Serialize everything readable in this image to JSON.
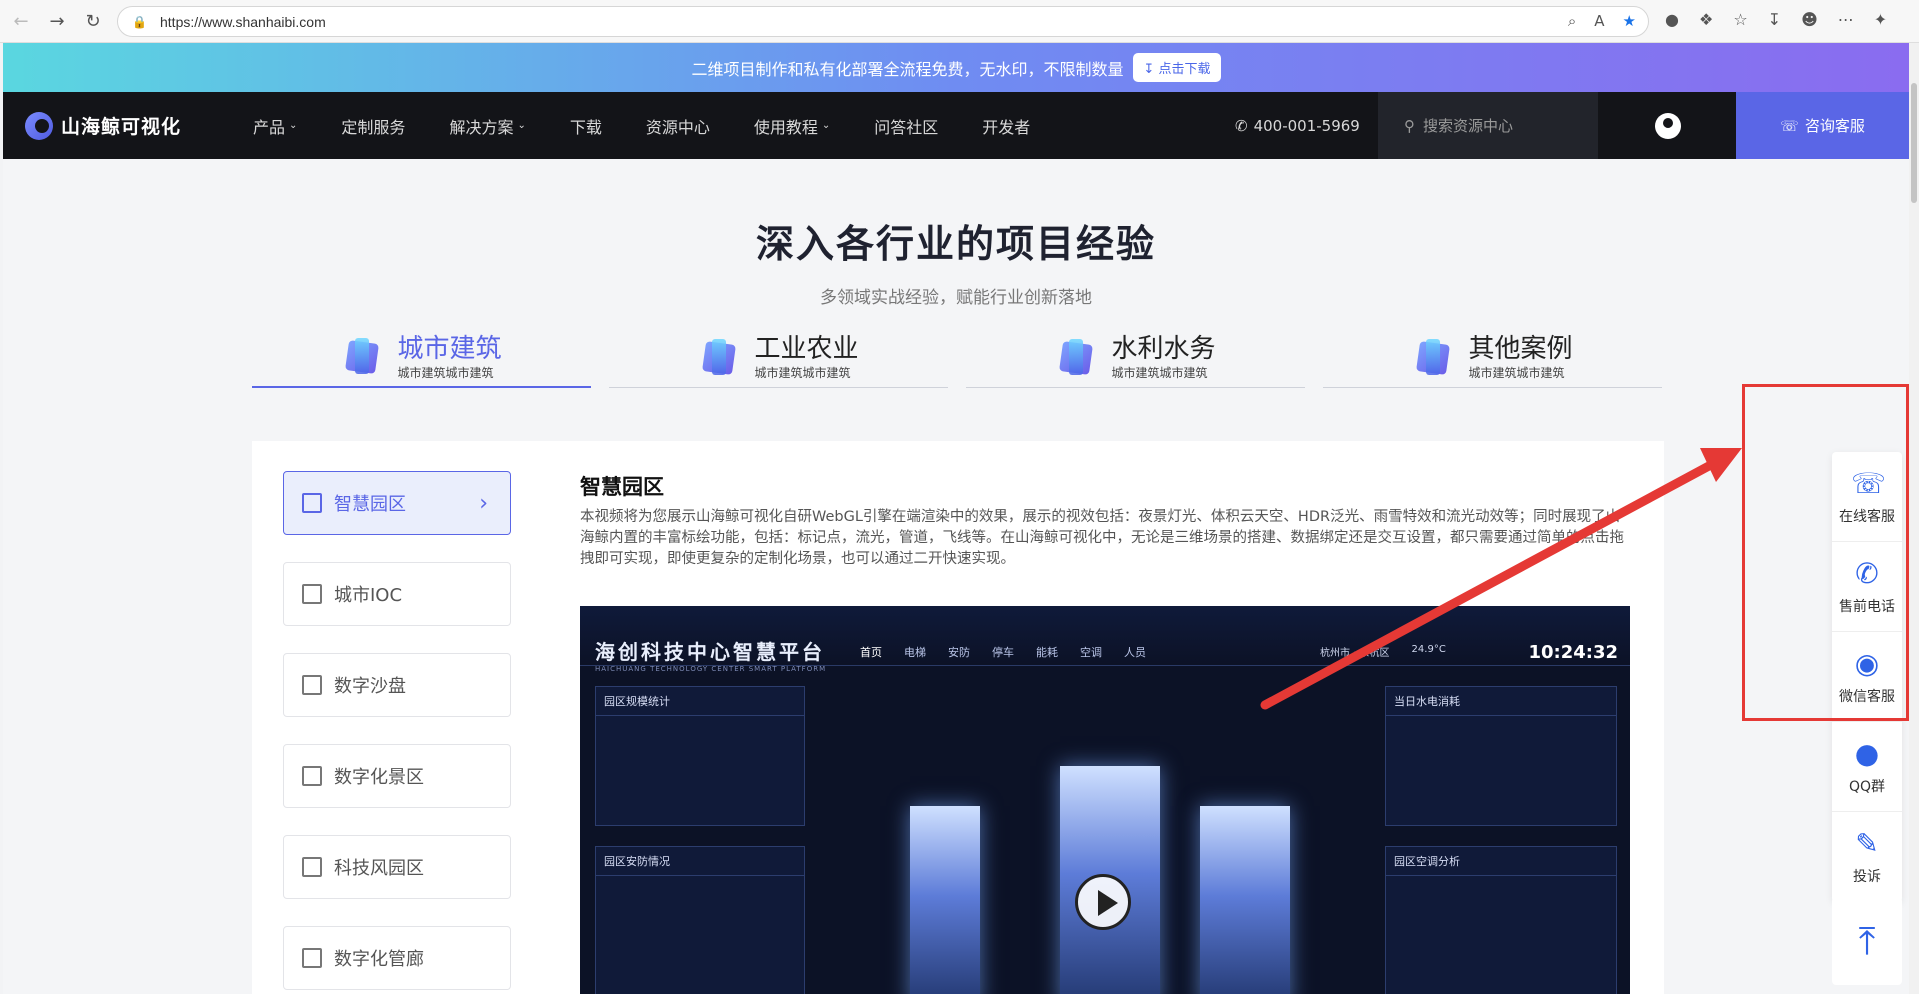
{
  "browser": {
    "url": "https://www.shanhaibi.com"
  },
  "promo": {
    "text": "二维项目制作和私有化部署全流程免费，无水印，不限制数量",
    "button": "点击下载"
  },
  "nav": {
    "logo": "山海鲸可视化",
    "menu": [
      {
        "label": "产品",
        "dropdown": true
      },
      {
        "label": "定制服务",
        "dropdown": false
      },
      {
        "label": "解决方案",
        "dropdown": true
      },
      {
        "label": "下载",
        "dropdown": false
      },
      {
        "label": "资源中心",
        "dropdown": false
      },
      {
        "label": "使用教程",
        "dropdown": true
      },
      {
        "label": "问答社区",
        "dropdown": false
      },
      {
        "label": "开发者",
        "dropdown": false
      }
    ],
    "phone": "400-001-5969",
    "search_placeholder": "搜索资源中心",
    "consult": "咨询客服"
  },
  "hero": {
    "title": "深入各行业的项目经验",
    "subtitle": "多领域实战经验，赋能行业创新落地"
  },
  "tabs": [
    {
      "name": "城市建筑",
      "sub": "城市建筑城市建筑"
    },
    {
      "name": "工业农业",
      "sub": "城市建筑城市建筑"
    },
    {
      "name": "水利水务",
      "sub": "城市建筑城市建筑"
    },
    {
      "name": "其他案例",
      "sub": "城市建筑城市建筑"
    }
  ],
  "sidebar": [
    {
      "label": "智慧园区"
    },
    {
      "label": "城市IOC"
    },
    {
      "label": "数字沙盘"
    },
    {
      "label": "数字化景区"
    },
    {
      "label": "科技风园区"
    },
    {
      "label": "数字化管廊"
    }
  ],
  "article": {
    "title": "智慧园区",
    "body": "本视频将为您展示山海鲸可视化自研WebGL引擎在端渲染中的效果，展示的视效包括：夜景灯光、体积云天空、HDR泛光、雨雪特效和流光动效等；同时展现了山海鲸内置的丰富标绘功能，包括：标记点，流光，管道，飞线等。在山海鲸可视化中，无论是三维场景的搭建、数据绑定还是交互设置，都只需要通过简单的点击拖拽即可实现，即使更复杂的定制化场景，也可以通过二开快速实现。"
  },
  "video": {
    "title": "海创科技中心智慧平台",
    "title_en": "HAICHUANG TECHNOLOGY CENTER SMART PLATFORM",
    "nav": [
      "首页",
      "电梯",
      "安防",
      "停车",
      "能耗",
      "空调",
      "人员"
    ],
    "location": "杭州市 · 余杭区",
    "temp": "24.9°C",
    "time": "10:24:32",
    "panel_left_top": "园区规模统计",
    "panel_left_bottom": "园区安防情况",
    "panel_right_top": "当日水电消耗",
    "panel_right_bottom": "园区空调分析"
  },
  "float_bar": [
    {
      "label": "在线客服",
      "icon": "headset-icon"
    },
    {
      "label": "售前电话",
      "icon": "phone-icon"
    },
    {
      "label": "微信客服",
      "icon": "wechat-icon"
    },
    {
      "label": "QQ群",
      "icon": "qq-icon"
    },
    {
      "label": "投诉",
      "icon": "complaint-icon"
    }
  ],
  "colors": {
    "accent": "#5a66e6",
    "nav_bg": "#131418",
    "annotation_red": "#e53935"
  }
}
